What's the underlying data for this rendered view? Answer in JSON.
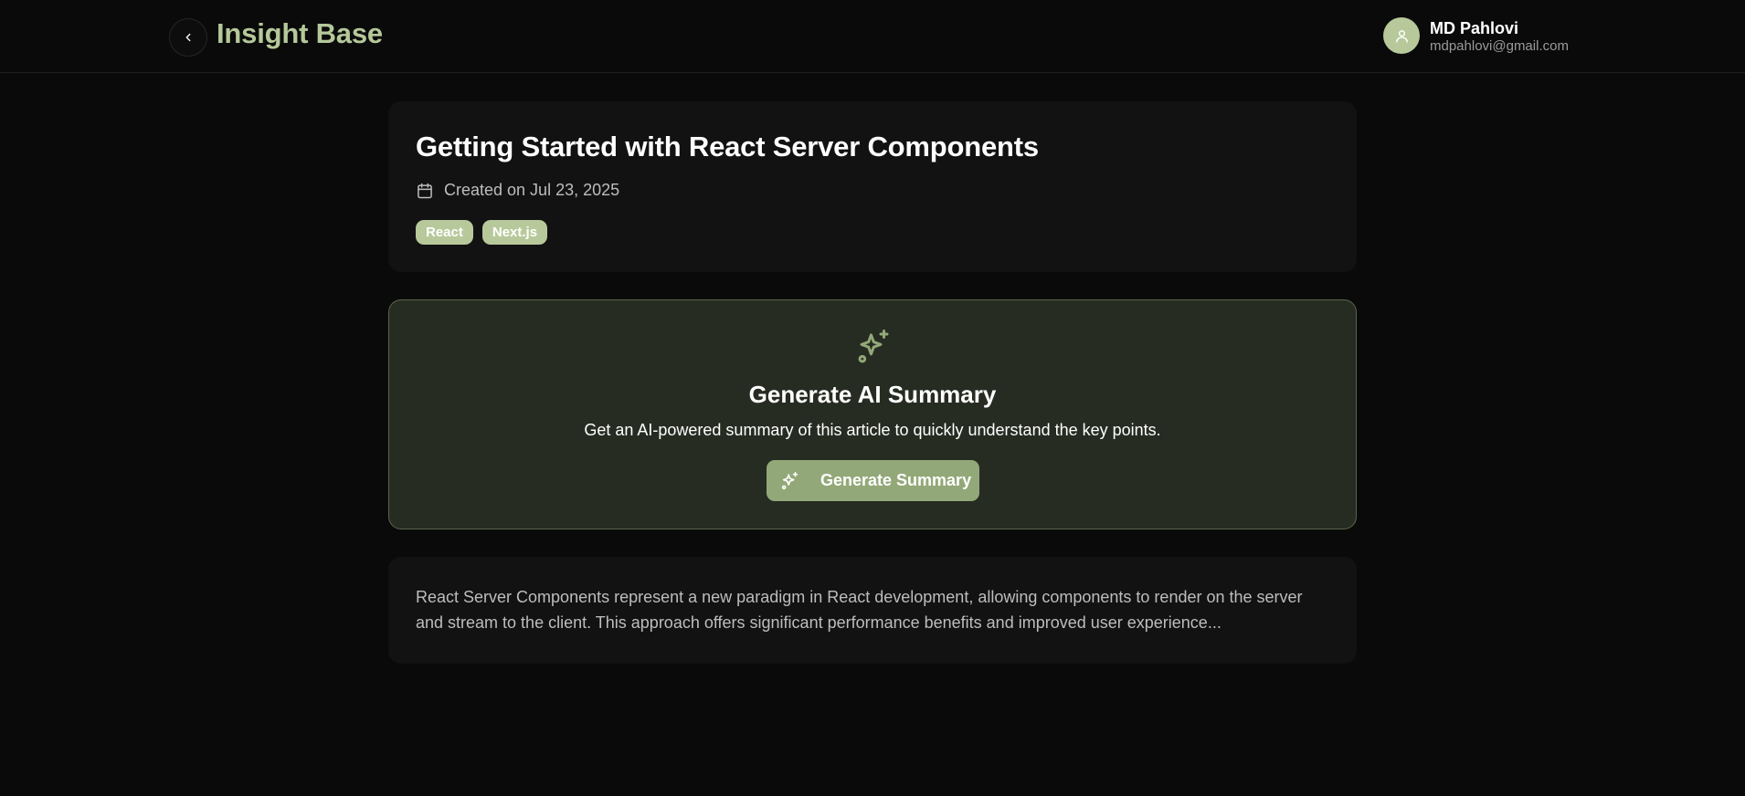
{
  "header": {
    "brand": "Insight Base",
    "back_icon": "chevron-left-icon",
    "user": {
      "avatar_icon": "user-icon",
      "name": "MD Pahlovi",
      "email": "mdpahlovi@gmail.com"
    }
  },
  "article": {
    "title": "Getting Started with React Server Components",
    "created_icon": "calendar-icon",
    "created": "Created on Jul 23, 2025",
    "tags": [
      "React",
      "Next.js"
    ]
  },
  "ai_summary": {
    "icon": "sparkles-icon",
    "title": "Generate AI Summary",
    "description": "Get an AI-powered summary of this article to quickly understand the key points.",
    "button_label": "Generate Summary"
  },
  "content": {
    "excerpt": "React Server Components represent a new paradigm in React development, allowing components to render on the server and stream to the client. This approach offers significant performance benefits and improved user experience..."
  },
  "colors": {
    "accent": "#b7c99a",
    "button": "#93a878",
    "ai_card_bg": "#272c22",
    "card_bg": "#121212",
    "page_bg": "#0a0a0a"
  }
}
